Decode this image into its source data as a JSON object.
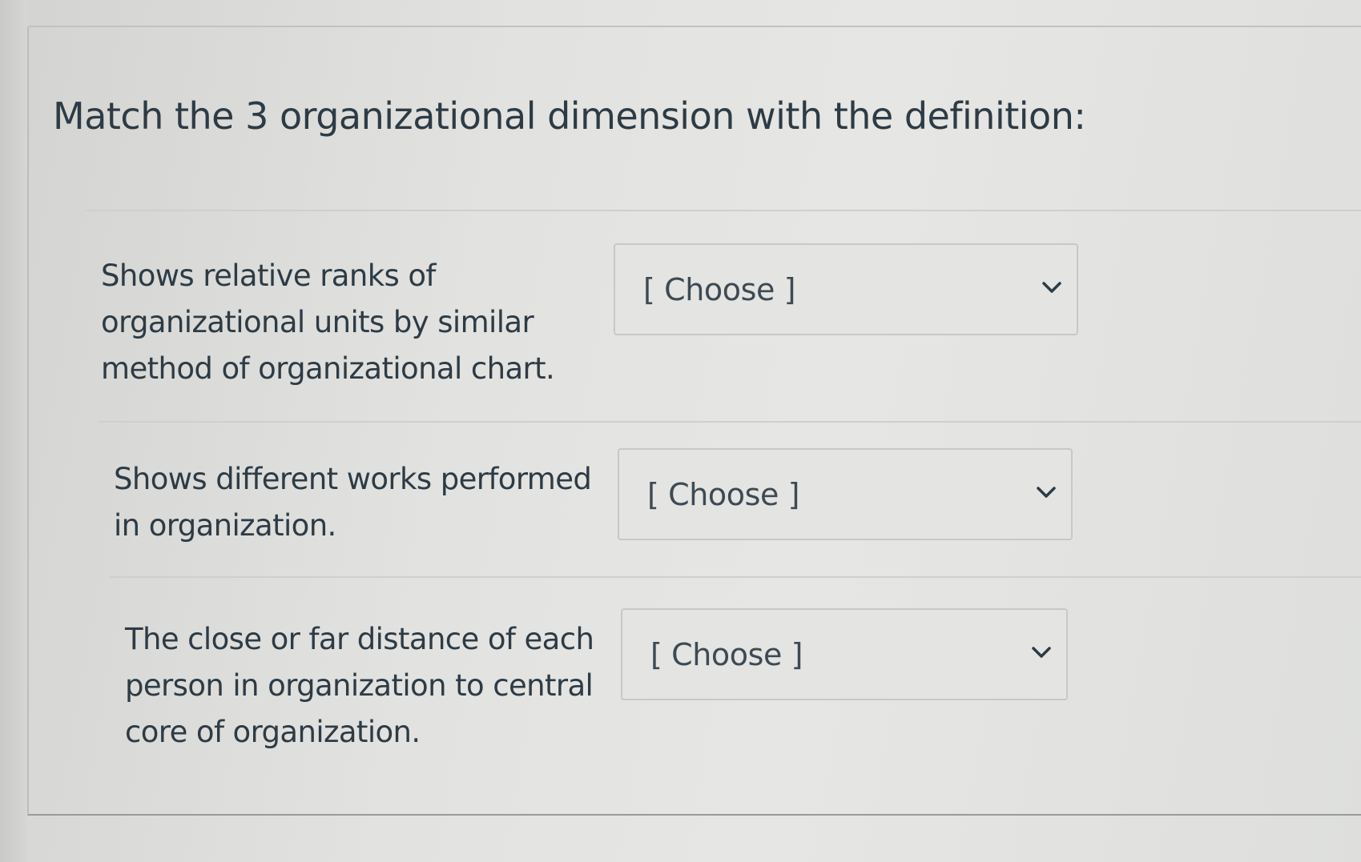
{
  "question": {
    "title": "Match the 3 organizational dimension with the definition:"
  },
  "rows": [
    {
      "prompt_lines": [
        "Shows relative ranks of",
        "organizational units by similar",
        "method of organizational chart."
      ],
      "select_value": "[ Choose ]"
    },
    {
      "prompt_lines": [
        "Shows different works performed",
        "in organization."
      ],
      "select_value": "[ Choose ]"
    },
    {
      "prompt_lines": [
        "The close or far distance of each",
        "person in organization to central",
        "core of organization."
      ],
      "select_value": "[ Choose ]"
    }
  ],
  "icons": {
    "dropdown": "chevron-down-icon"
  },
  "colors": {
    "text": "#2d3b45",
    "select_border": "#c8c8c6"
  }
}
